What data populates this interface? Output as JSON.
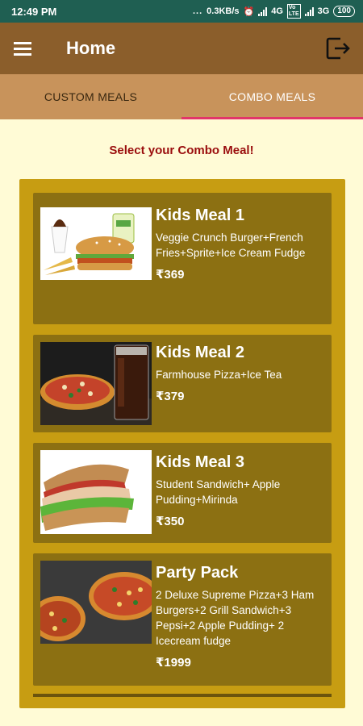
{
  "status_bar": {
    "time": "12:49 PM",
    "dots": "...",
    "speed": "0.3KB/s",
    "network1": "4G",
    "network2": "3G",
    "battery": "100"
  },
  "app_bar": {
    "title": "Home",
    "menu_icon": "hamburger-menu-icon",
    "logout_icon": "logout-icon"
  },
  "tabs": [
    {
      "label": "CUSTOM MEALS",
      "active": false
    },
    {
      "label": "COMBO MEALS",
      "active": true
    }
  ],
  "heading": "Select your Combo Meal!",
  "meals": [
    {
      "name": "Kids Meal 1",
      "description": "Veggie Crunch Burger+French Fries+Sprite+Ice Cream Fudge",
      "price": "₹369",
      "image": "burger-fries-drink-sundae"
    },
    {
      "name": "Kids Meal 2",
      "description": "Farmhouse Pizza+Ice Tea",
      "price": "₹379",
      "image": "pizza-cola"
    },
    {
      "name": "Kids Meal 3",
      "description": "Student Sandwich+ Apple Pudding+Mirinda",
      "price": "₹350",
      "image": "sandwich"
    },
    {
      "name": "Party Pack",
      "description": "2 Deluxe Supreme Pizza+3 Ham Burgers+2 Grill Sandwich+3 Pepsi+2 Apple Pudding+ 2 Icecream fudge",
      "price": "₹1999",
      "image": "pizzas"
    }
  ],
  "colors": {
    "status_bar": "#1f5f52",
    "app_bar": "#8b5e2b",
    "tabs": "#c8935b",
    "tab_indicator": "#e2356a",
    "background": "#fffbd6",
    "heading": "#9a0d0d",
    "panel": "#c79d12",
    "card": "#8c7012"
  }
}
